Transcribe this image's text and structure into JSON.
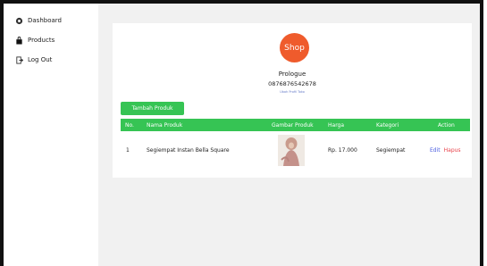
{
  "sidebar": {
    "items": [
      {
        "label": "Dashboard",
        "icon": "gauge-icon"
      },
      {
        "label": "Products",
        "icon": "bag-icon"
      },
      {
        "label": "Log Out",
        "icon": "logout-icon"
      }
    ]
  },
  "store": {
    "logo_text": "Shop",
    "name": "Prologue",
    "phone": "0876876542678",
    "link": "Ubah Profil Toko"
  },
  "toolbar": {
    "add_label": "Tambah Produk"
  },
  "table": {
    "headers": [
      "No.",
      "Nama Produk",
      "Gambar Produk",
      "Harga",
      "Kategori",
      "Action"
    ],
    "rows": [
      {
        "no": "1",
        "name": "Segiempat Instan Bella Square",
        "price": "Rp. 17.000",
        "category": "Segiempat",
        "edit": "Edit",
        "delete": "Hapus"
      }
    ]
  },
  "colors": {
    "accent": "#36c454",
    "logo": "#ef5b2c",
    "edit": "#4b5ee0",
    "delete": "#e8424a"
  }
}
